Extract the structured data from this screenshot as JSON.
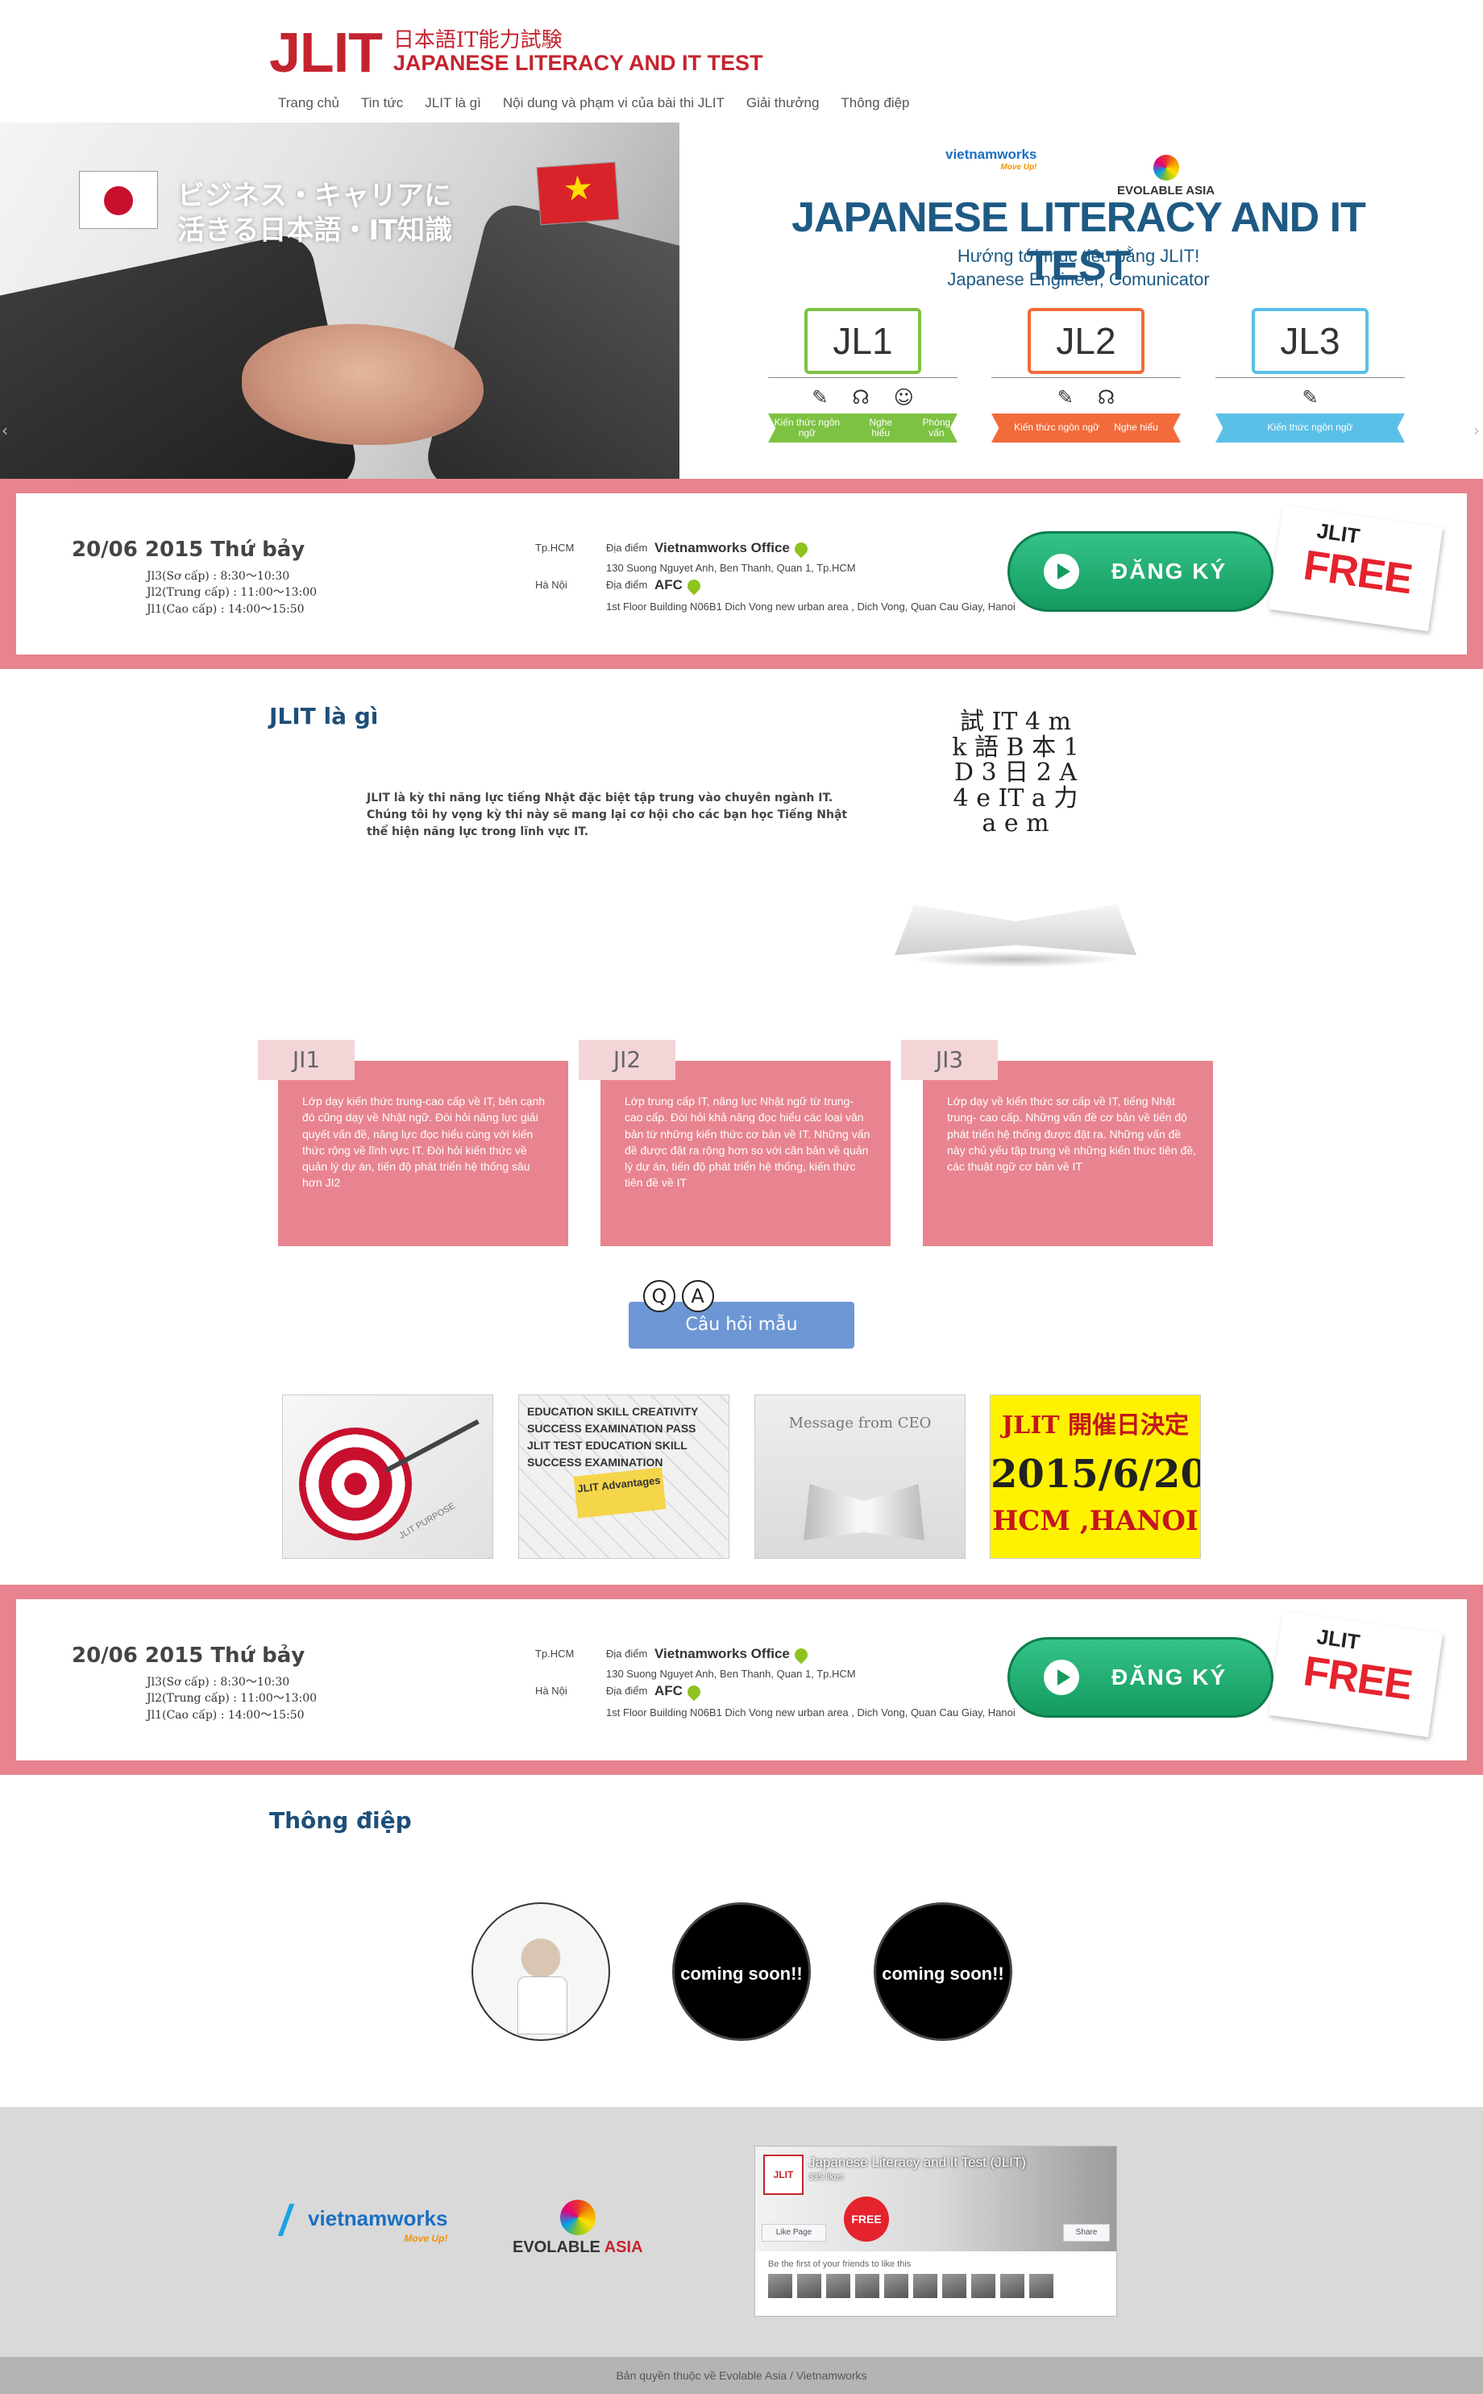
{
  "header": {
    "logo_mark": "JLIT",
    "logo_jp": "日本語IT能力試験",
    "logo_en": "JAPANESE LITERACY AND IT TEST"
  },
  "nav": [
    "Trang chủ",
    "Tin tức",
    "JLIT là gì",
    "Nội dung và phạm vi của bài thi JLIT",
    "Giải thưởng",
    "Thông điệp"
  ],
  "hero": {
    "catch_line1": "ビジネス・キャリアに",
    "catch_line2": "活きる日本語・IT知識",
    "sponsor1": "vietnamworks",
    "sponsor1_sub": "Move Up!",
    "sponsor2": "EVOLABLE ASIA",
    "title": "JAPANESE LITERACY AND IT TEST",
    "subtitle": "Hướng tới mục tiêu bằng JLIT! Japanese Engineer, Comunicator",
    "levels": [
      {
        "label": "JL1",
        "color": "#7dc242",
        "ribbon": [
          "Kiến thức ngôn ngữ",
          "Nghe hiểu",
          "Phòng vấn"
        ]
      },
      {
        "label": "JL2",
        "color": "#f26b3a",
        "ribbon": [
          "Kiến thức ngôn ngữ",
          "Nghe hiểu"
        ]
      },
      {
        "label": "JL3",
        "color": "#5bc0e8",
        "ribbon": [
          "Kiến thức ngôn ngữ"
        ]
      }
    ]
  },
  "event": {
    "date": "20/06 2015 Thứ bảy",
    "times": [
      "Jl3(Sơ cấp) : 8:30〜10:30",
      "Jl2(Trung cấp) : 11:00〜13:00",
      "Jl1(Cao cấp) : 14:00〜15:50"
    ],
    "city1": "Tp.HCM",
    "city2": "Hà Nội",
    "place_label": "Địa điểm",
    "venue1": "Vietnamworks Office",
    "addr1": "130 Suong Nguyet Anh, Ben Thanh, Quan 1, Tp.HCM",
    "venue2": "AFC",
    "addr2": "1st Floor Building N06B1 Dich Vong new urban area , Dich Vong, Quan Cau Giay, Hanoi",
    "register": "ĐĂNG KÝ",
    "free_jlit": "JLIT",
    "free": "FREE"
  },
  "about": {
    "title": "JLIT là gì",
    "text": "JLIT là kỳ thi năng lực tiếng Nhật đặc biệt tập trung vào chuyên ngành IT. Chúng tôi hy vọng kỳ thi này sẽ mang lại cơ hội cho các bạn học Tiếng Nhật thể hiện năng lực trong lĩnh vực IT.",
    "book_glyphs": "試 IT 4 m k 語 B 本 1 D 3 日 2 A 4 e IT a 力 a e m"
  },
  "cards": [
    {
      "tab": "JI1",
      "text": "Lớp dạy kiến thức trung-cao cấp về IT, bên cạnh đó cũng dạy về Nhật ngữ. Đòi hỏi năng lực giải quyết vấn đề, năng lực đọc hiểu cùng với kiến thức rộng về lĩnh vực IT. Đòi hỏi kiến thức về quản lý dự án, tiến độ phát triển hệ thống sâu hơn JI2"
    },
    {
      "tab": "JI2",
      "text": "Lớp trung cấp IT, năng lực Nhật ngữ từ trung- cao cấp. Đòi hỏi khả năng đọc hiểu các loại văn bản từ những kiến thức cơ bản về IT. Những vấn đề được đặt ra rộng hơn so với căn bản về quản lý dự án, tiến độ phát triển hệ thống, kiến thức tiên đề về IT"
    },
    {
      "tab": "JI3",
      "text": "Lớp dạy về kiến thức sơ cấp về IT, tiếng Nhật trung- cao cấp. Những vấn đề cơ bản về tiến độ phát triển hệ thống được đặt ra. Những vấn đề này chủ yếu tập trung về những kiến thức tiên đề, các thuật ngữ cơ bản về IT"
    }
  ],
  "qa": {
    "label": "Câu hỏi mẫu",
    "q": "Q",
    "a": "A"
  },
  "thumbs": {
    "t1_caption": "JLIT PURPOSE",
    "t2_words": "EDUCATION SKILL CREATIVITY SUCCESS EXAMINATION PASS JLIT TEST EDUCATION SKILL SUCCESS EXAMINATION",
    "t2_badge": "JLIT Advantages",
    "t3_caption": "Message from CEO",
    "t4_line1": "JLIT 開催日決定",
    "t4_line2": "2015/6/20",
    "t4_line3": "HCM ,HANOI"
  },
  "message": {
    "title": "Thông điệp",
    "soon": "coming soon!!"
  },
  "footer": {
    "vnw": "vietnamworks",
    "vnw_sub": "Move Up!",
    "ea1": "EVOLABLE",
    "ea2": "ASIA",
    "fb_title": "Japanese Literacy and It Test (JLIT)",
    "fb_likes": "335 likes",
    "fb_logo": "JLIT",
    "fb_free": "FREE",
    "fb_like": "Like Page",
    "fb_share": "Share",
    "fb_friends": "Be the first of your friends to like this",
    "copyright": "Bản quyền thuộc về Evolable Asia / Vietnamworks"
  }
}
